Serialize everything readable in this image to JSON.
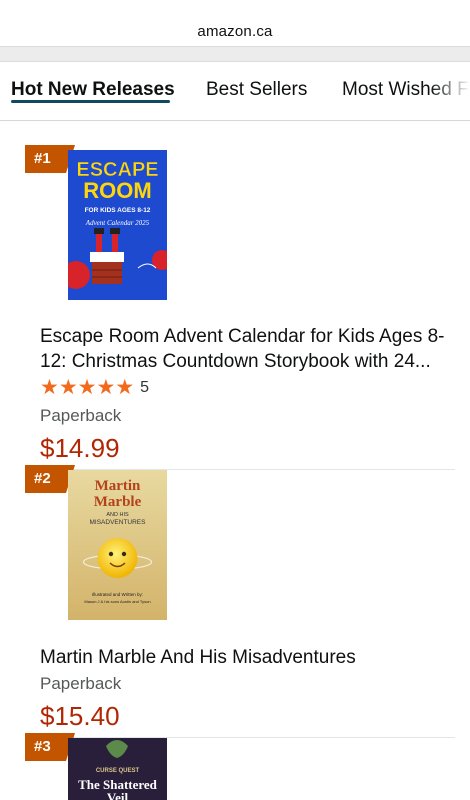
{
  "browser": {
    "url": "amazon.ca"
  },
  "tabs": [
    {
      "label": "Hot New Releases",
      "active": true
    },
    {
      "label": "Best Sellers",
      "active": false
    },
    {
      "label": "Most Wished For",
      "active": false
    }
  ],
  "items": [
    {
      "rank": "#1",
      "title": "Escape Room Advent Calendar for Kids Ages 8-12: Christmas Countdown Storybook with 24...",
      "title_line1": "Escape Room Advent Calendar for Kids Ages 8-",
      "title_line2": "12: Christmas Countdown Storybook with 24...",
      "rating": 5,
      "rating_count": "5",
      "format": "Paperback",
      "price": "$14.99",
      "cover": {
        "line1": "ESCAPE",
        "line2": "ROOM",
        "line3": "FOR KIDS AGES 8-12",
        "line4": "Advent Calendar 2025"
      }
    },
    {
      "rank": "#2",
      "title": "Martin Marble And His Misadventures",
      "format": "Paperback",
      "price": "$15.40",
      "cover": {
        "line1": "Martin",
        "line2": "Marble",
        "line3": "AND HIS",
        "line4": "MISADVENTURES",
        "line5": "Illustrated and Written by:",
        "line6": "Mason J & his sons Austin and Tyson"
      }
    },
    {
      "rank": "#3",
      "cover": {
        "line1": "CURSE QUEST",
        "line2": "The Shattered",
        "line3": "Veil"
      }
    }
  ],
  "colors": {
    "rank_badge": "#c45500",
    "price": "#b12704",
    "star": "#f26b1d",
    "tab_underline": "#0f4b5f"
  }
}
